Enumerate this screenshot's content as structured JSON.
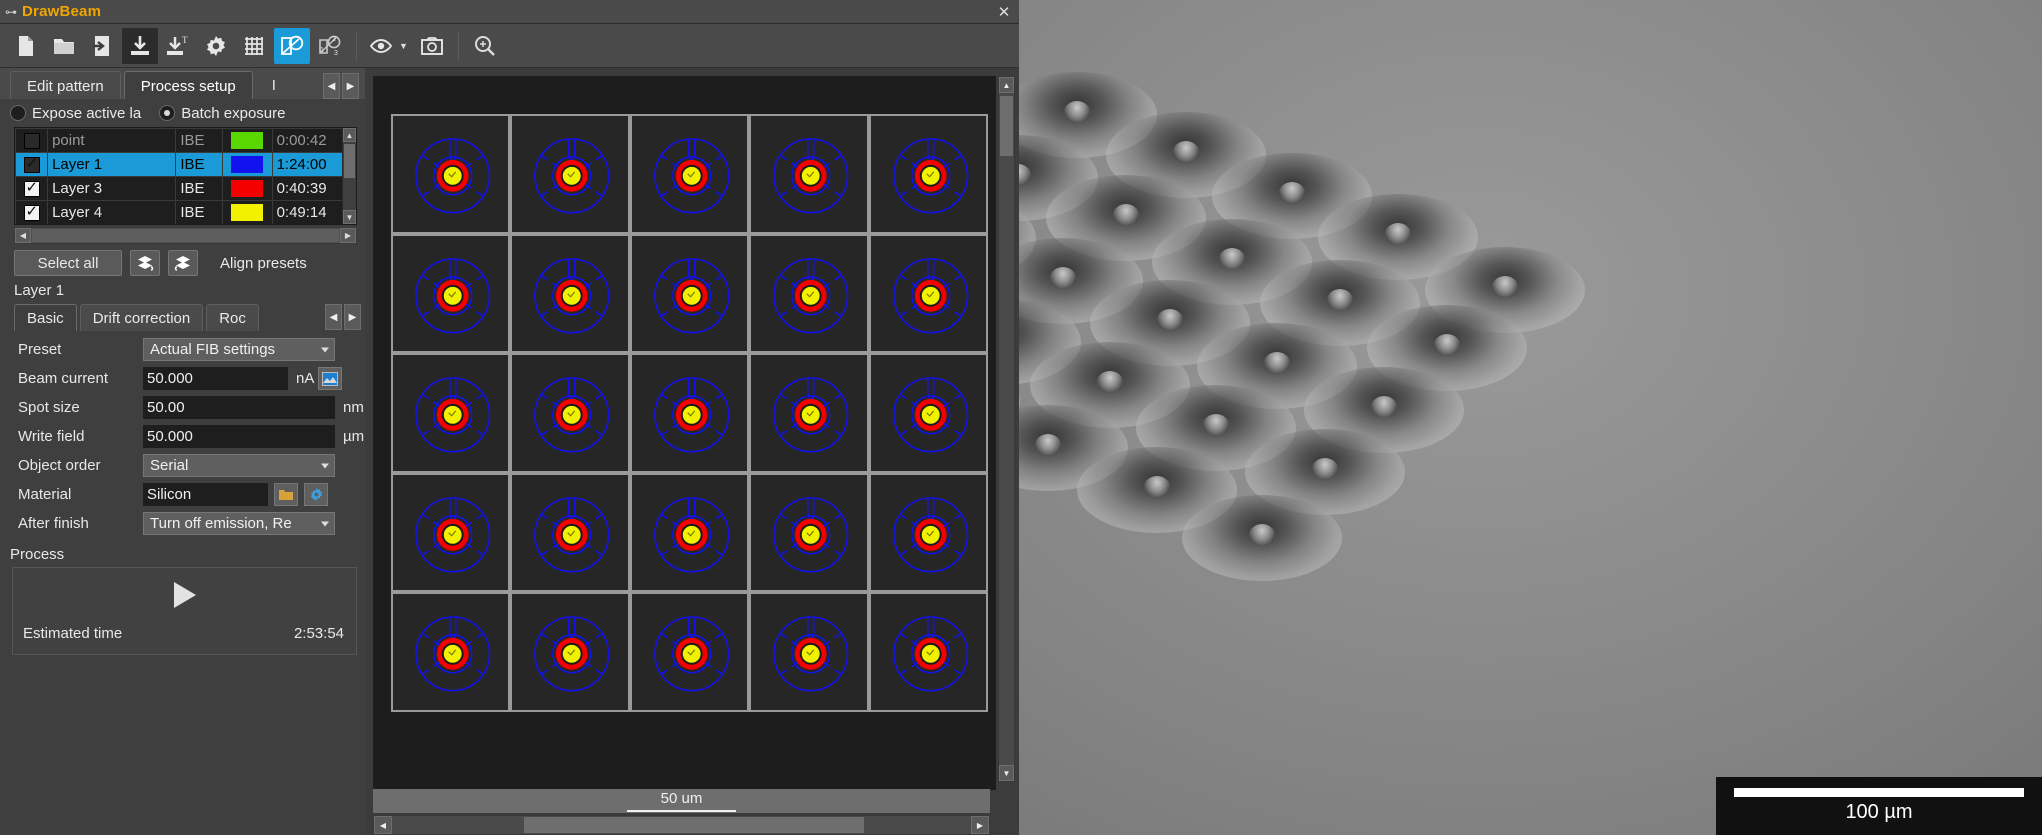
{
  "window": {
    "title": "DrawBeam",
    "close_label": "✕",
    "icon": "window-menu-icon"
  },
  "toolbar": {
    "buttons": [
      {
        "name": "new-file-icon",
        "state": "normal"
      },
      {
        "name": "open-folder-icon",
        "state": "normal"
      },
      {
        "name": "import-file-icon",
        "state": "normal"
      },
      {
        "name": "save-icon",
        "state": "dark"
      },
      {
        "name": "save-as-text-icon",
        "state": "normal"
      },
      {
        "name": "settings-gear-icon",
        "state": "normal"
      },
      {
        "name": "grid-icon",
        "state": "normal"
      },
      {
        "name": "edit-shape-icon",
        "state": "selected"
      },
      {
        "name": "object-order-icon",
        "state": "normal"
      },
      {
        "name": "preview-eye-icon",
        "state": "normal"
      },
      {
        "name": "snapshot-icon",
        "state": "normal"
      },
      {
        "name": "zoom-search-icon",
        "state": "normal"
      }
    ]
  },
  "tabs": {
    "main": [
      {
        "label": "Edit pattern",
        "active": false
      },
      {
        "label": "Process setup",
        "active": true
      },
      {
        "label": "I",
        "active": false
      }
    ],
    "nav_prev": "◀",
    "nav_next": "▶"
  },
  "exposure_mode": {
    "option_active_label": "Expose active la",
    "option_batch_label": "Batch exposure",
    "selected": "batch"
  },
  "layer_table": {
    "rows": [
      {
        "checked": false,
        "name": "point",
        "type": "IBE",
        "color": "#58d800",
        "time": "0:00:42",
        "selected": false,
        "partial": true
      },
      {
        "checked": true,
        "name": "Layer 1",
        "type": "IBE",
        "color": "#1212ee",
        "time": "1:24:00",
        "selected": true,
        "partial": false
      },
      {
        "checked": true,
        "name": "Layer 3",
        "type": "IBE",
        "color": "#f40000",
        "time": "0:40:39",
        "selected": false,
        "partial": false
      },
      {
        "checked": true,
        "name": "Layer 4",
        "type": "IBE",
        "color": "#f2f200",
        "time": "0:49:14",
        "selected": false,
        "partial": false
      }
    ]
  },
  "layer_actions": {
    "select_all_label": "Select all",
    "move_up_icon": "layers-up-icon",
    "move_down_icon": "layers-down-icon",
    "align_presets_label": "Align presets"
  },
  "selected_layer_label": "Layer 1",
  "settings_tabs": [
    {
      "label": "Basic",
      "active": true
    },
    {
      "label": "Drift correction",
      "active": false
    },
    {
      "label": "Roc",
      "active": false
    }
  ],
  "settings": {
    "preset": {
      "label": "Preset",
      "value": "Actual FIB settings"
    },
    "beam_current": {
      "label": "Beam current",
      "value": "50.000",
      "unit": "nA",
      "has_picker": true
    },
    "spot_size": {
      "label": "Spot size",
      "value": "50.00",
      "unit": "nm"
    },
    "write_field": {
      "label": "Write field",
      "value": "50.000",
      "unit": "µm"
    },
    "object_order": {
      "label": "Object order",
      "value": "Serial"
    },
    "material": {
      "label": "Material",
      "value": "Silicon",
      "browse_icon": "folder-icon",
      "config_icon": "gear-icon"
    },
    "after_finish": {
      "label": "After finish",
      "value": "Turn off emission, Re"
    }
  },
  "process": {
    "section_label": "Process",
    "start_icon": "play-icon",
    "estimated_time_label": "Estimated time",
    "estimated_time_value": "2:53:54"
  },
  "canvas": {
    "scalebar_label": "50 um",
    "grid": {
      "cols": 5,
      "rows": 5
    },
    "pattern_colors": {
      "outer_ring": "#1212ee",
      "mid_ring": "#f40000",
      "core": "#f2f200"
    }
  },
  "sem": {
    "scalebar_label": "100 µm"
  }
}
